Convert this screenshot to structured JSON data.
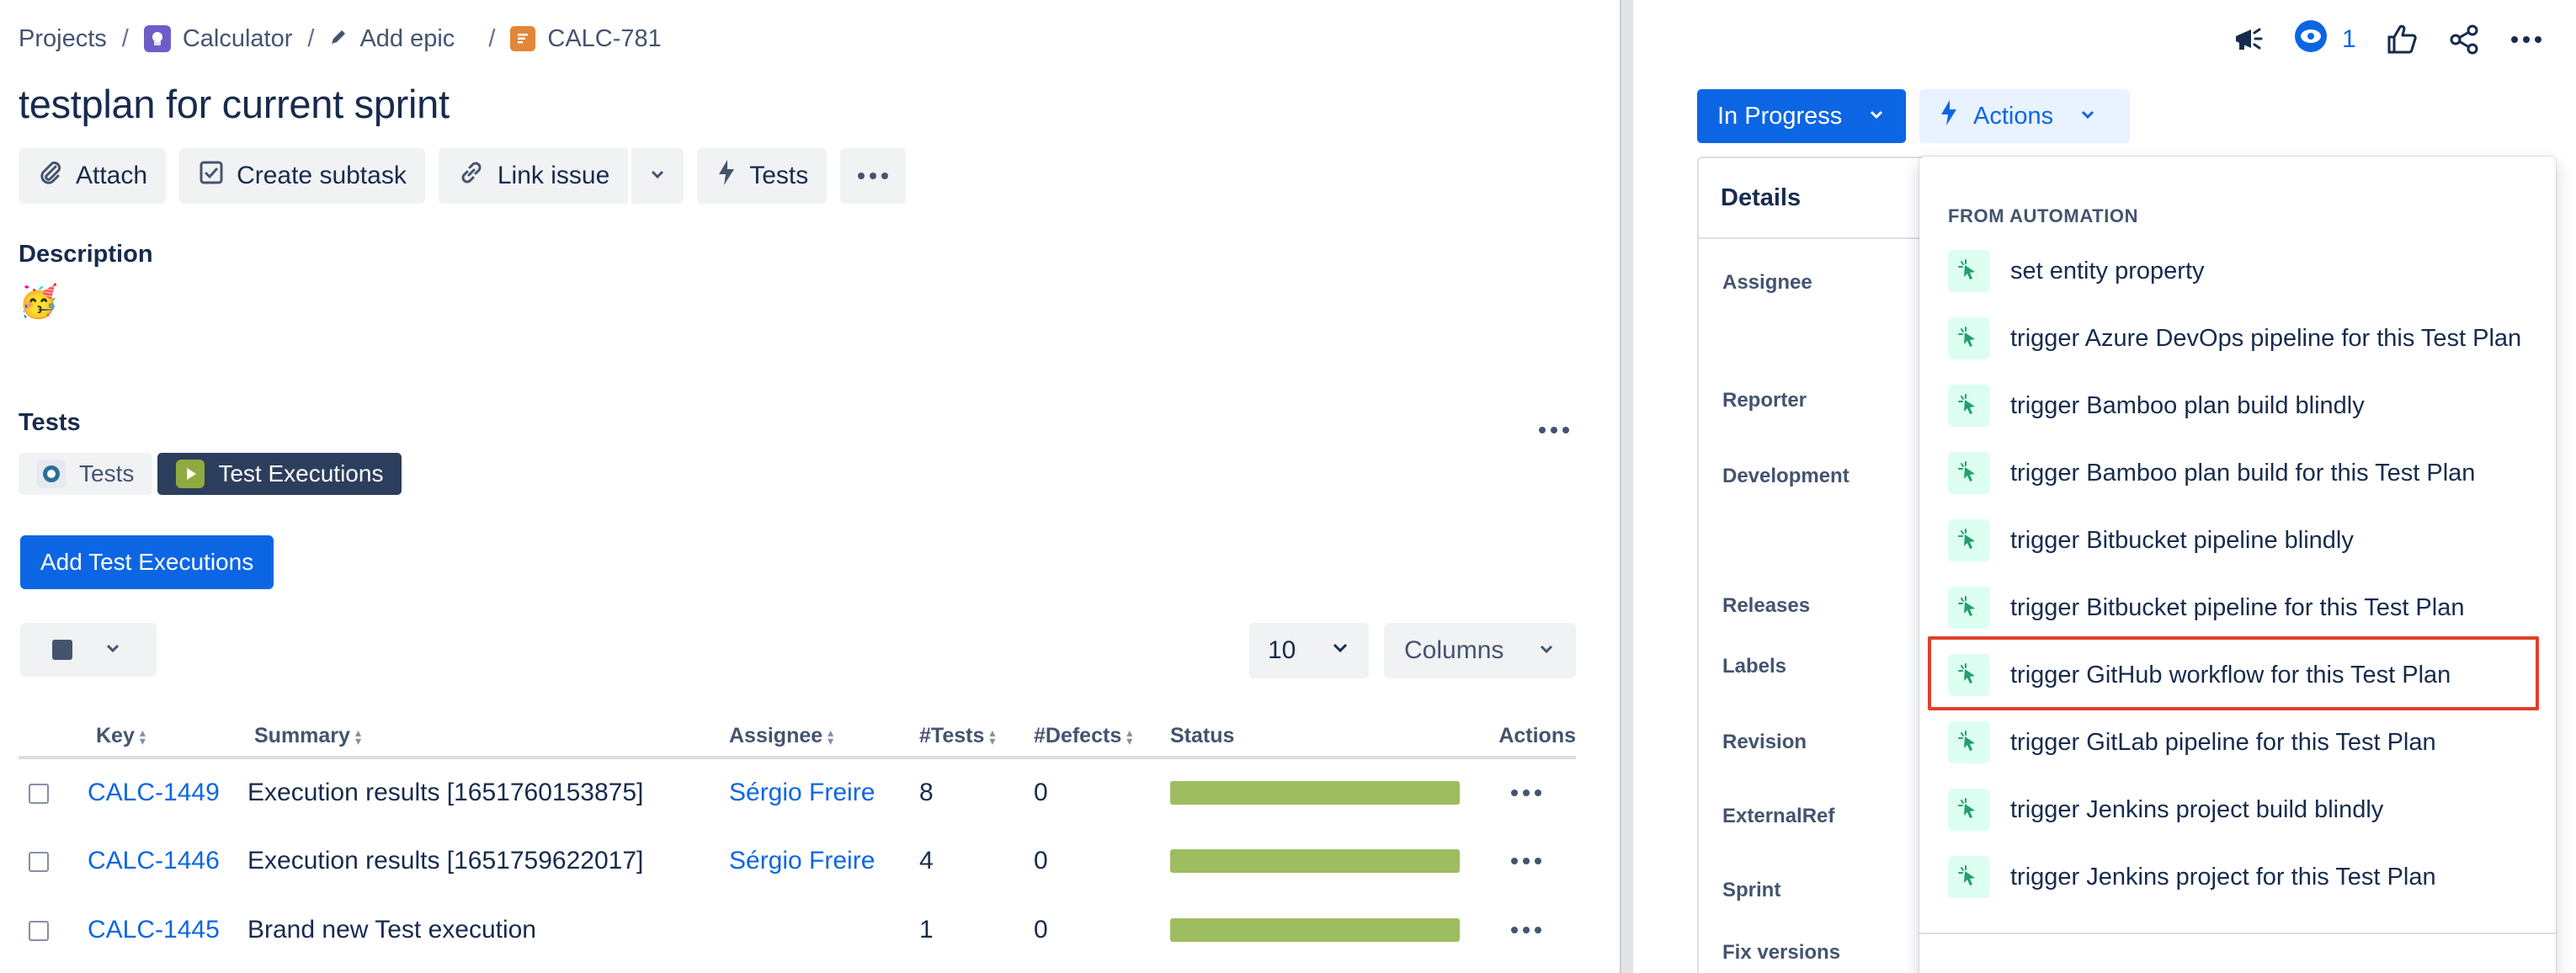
{
  "breadcrumb": {
    "projects": "Projects",
    "project": "Calculator",
    "epic": "Add epic",
    "issue_key": "CALC-781",
    "separator": "/"
  },
  "issue": {
    "title": "testplan for current sprint"
  },
  "toolbar": {
    "attach": "Attach",
    "create_subtask": "Create subtask",
    "link_issue": "Link issue",
    "tests": "Tests"
  },
  "description": {
    "label": "Description",
    "emoji": "🥳"
  },
  "tests_section": {
    "label": "Tests",
    "tabs": [
      {
        "label": "Tests",
        "active": false
      },
      {
        "label": "Test Executions",
        "active": true
      }
    ],
    "add_button": "Add Test Executions",
    "page_size": "10",
    "columns_button": "Columns",
    "headers": {
      "key": "Key",
      "summary": "Summary",
      "assignee": "Assignee",
      "tests": "#Tests",
      "defects": "#Defects",
      "status": "Status",
      "actions": "Actions"
    },
    "rows": [
      {
        "key": "CALC-1449",
        "summary": "Execution results [1651760153875]",
        "assignee": "Sérgio Freire",
        "tests": "8",
        "defects": "0",
        "status_pass_fraction": 1.0
      },
      {
        "key": "CALC-1446",
        "summary": "Execution results [1651759622017]",
        "assignee": "Sérgio Freire",
        "tests": "4",
        "defects": "0",
        "status_pass_fraction": 1.0
      },
      {
        "key": "CALC-1445",
        "summary": "Brand new Test execution",
        "assignee": "",
        "tests": "1",
        "defects": "0",
        "status_pass_fraction": 1.0
      }
    ]
  },
  "header_actions": {
    "watch_count": "1"
  },
  "status_button": {
    "label": "In Progress"
  },
  "actions_button": {
    "label": "Actions"
  },
  "details": {
    "header": "Details",
    "fields": [
      "Assignee",
      "Reporter",
      "Development",
      "Releases",
      "Labels",
      "Revision",
      "ExternalRef",
      "Sprint",
      "Fix versions"
    ]
  },
  "automation_menu": {
    "heading": "FROM AUTOMATION",
    "items": [
      "set entity property",
      "trigger Azure DevOps pipeline for this Test Plan",
      "trigger Bamboo plan build blindly",
      "trigger Bamboo plan build for this Test Plan",
      "trigger Bitbucket pipeline blindly",
      "trigger Bitbucket pipeline for this Test Plan",
      "trigger GitHub workflow for this Test Plan",
      "trigger GitLab pipeline for this Test Plan",
      "trigger Jenkins project build blindly",
      "trigger Jenkins project for this Test Plan"
    ],
    "highlighted_index": 6
  },
  "colors": {
    "primary": "#0c66e4",
    "status_pass": "#9ebd61",
    "highlight_border": "#e0402b",
    "tab_active_bg": "#2c3e5d",
    "automation_icon_bg": "#dcfff1",
    "automation_icon": "#22a06b"
  },
  "icons": {
    "breadcrumb_project": "calculator-project-icon",
    "breadcrumb_epic": "pencil-icon",
    "breadcrumb_issue": "story-icon",
    "attach": "paperclip-icon",
    "subtask": "subtask-icon",
    "link": "link-icon",
    "tests": "lightning-icon",
    "more": "more-icon",
    "announce": "megaphone-icon",
    "watch": "eye-icon",
    "like": "thumbs-up-icon",
    "share": "share-icon",
    "automation": "automation-cursor-icon"
  }
}
